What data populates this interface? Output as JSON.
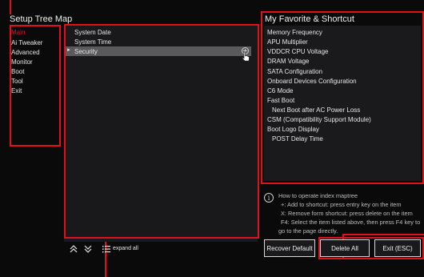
{
  "left": {
    "title": "Setup Tree Map",
    "items": [
      "Main",
      "Ai Tweaker",
      "Advanced",
      "Monitor",
      "Boot",
      "Tool",
      "Exit"
    ]
  },
  "tree": {
    "items": [
      "System Date",
      "System Time",
      "Security"
    ],
    "selected_arrow": "►",
    "expand_label": "expand all"
  },
  "favorites": {
    "title": "My Favorite & Shortcut",
    "items": [
      "Memory Frequency",
      "APU Multiplier",
      "VDDCR CPU Voltage",
      "DRAM Voltage",
      "SATA Configuration",
      "Onboard Devices Configuration",
      "C6 Mode",
      "Fast Boot",
      "Next Boot after AC Power Loss",
      "CSM (Compatibility Support Module)",
      "Boot Logo Display",
      "POST Delay Time"
    ]
  },
  "help": {
    "line1": "How to operate index maptree",
    "line2": "+: Add to shortcut: press entry key on the item",
    "line3": "X: Remove form shortcut: press delete on the item",
    "line4": "F4: Select the item listed above, then press F4 key to",
    "line5": "go to the page directly."
  },
  "buttons": {
    "recover": "Recover Default",
    "delete_all": "Delete All",
    "exit": "Exit (ESC)"
  },
  "icons": {
    "collapse": "double-chevron-up-icon",
    "expand": "double-chevron-down-icon",
    "expand_all": "list-icon",
    "add": "plus-icon",
    "cursor": "hand-pointer-icon",
    "info": "info-icon"
  },
  "colors": {
    "accent_red": "#e0111b",
    "selected_row": "#5a5a5c",
    "panel_bg": "#1c1c1e"
  }
}
